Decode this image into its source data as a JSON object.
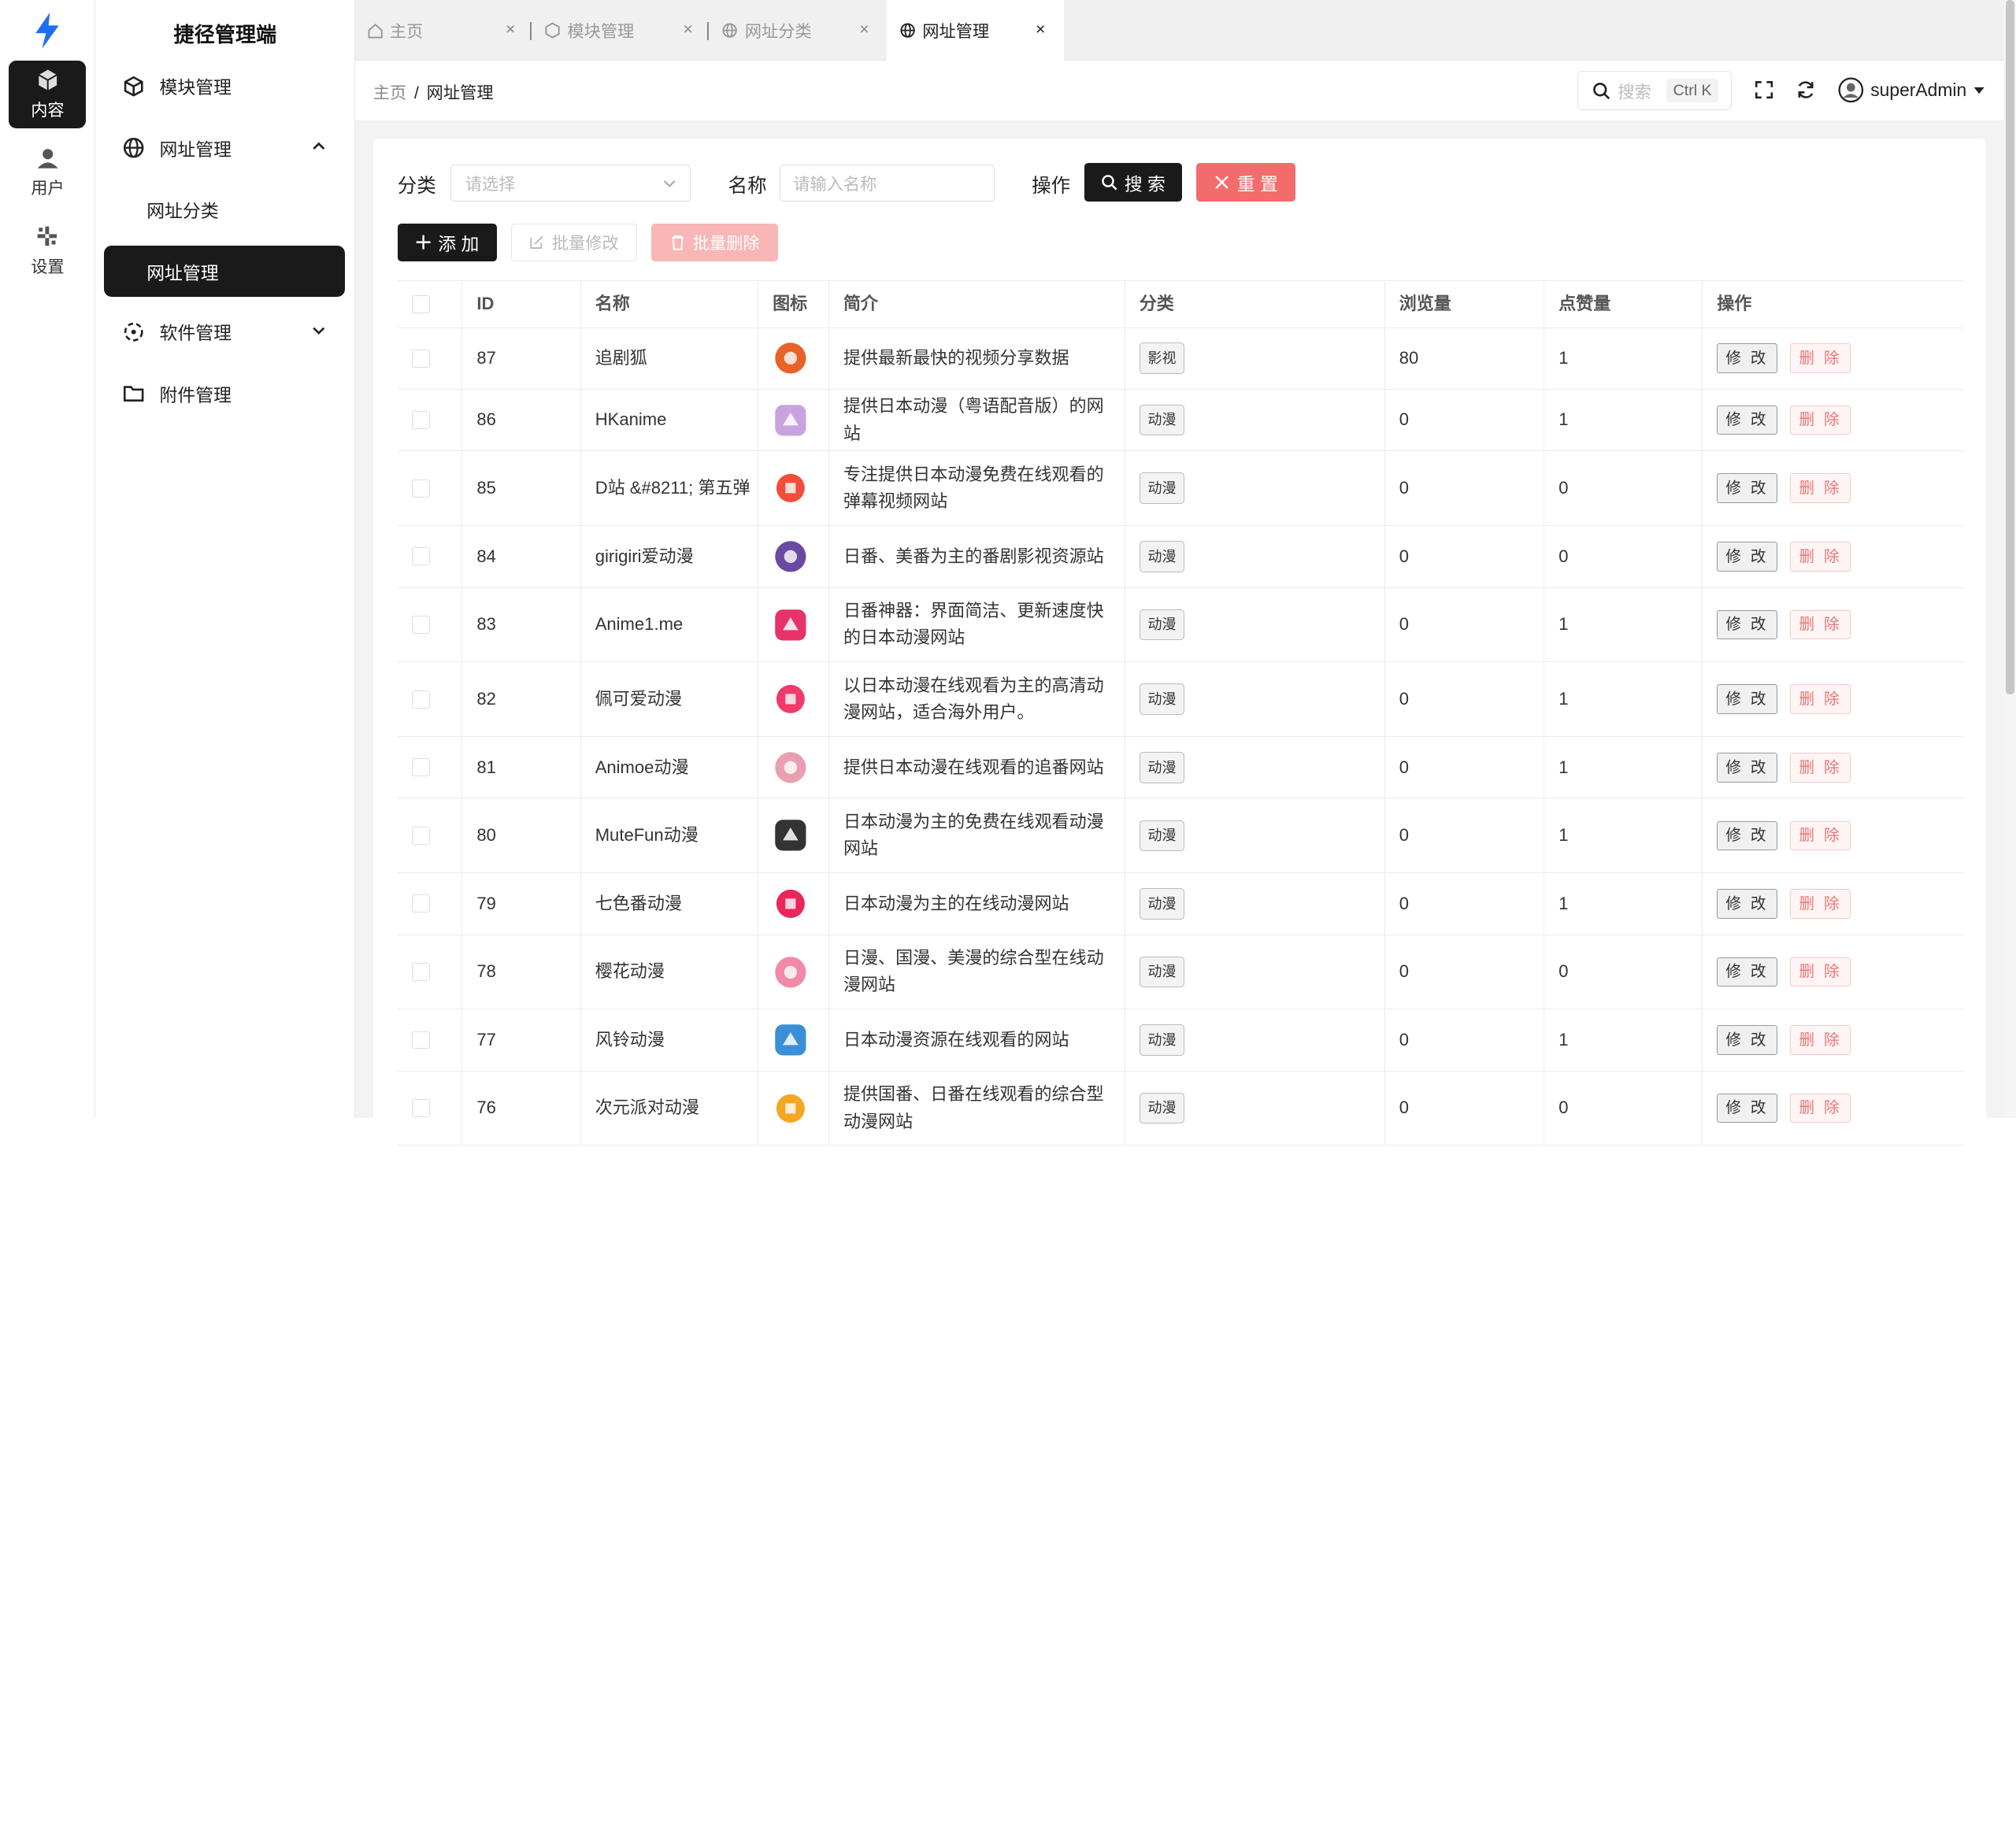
{
  "rail": {
    "items": [
      {
        "label": "内容",
        "icon": "cube-icon"
      },
      {
        "label": "用户",
        "icon": "user-icon"
      },
      {
        "label": "设置",
        "icon": "settings-icon"
      }
    ]
  },
  "sidebar": {
    "brand": "捷径管理端",
    "items": [
      {
        "label": "模块管理"
      },
      {
        "label": "网址管理"
      },
      {
        "label": "网址分类"
      },
      {
        "label": "网址管理"
      },
      {
        "label": "软件管理"
      },
      {
        "label": "附件管理"
      }
    ]
  },
  "tabs": [
    {
      "label": "主页"
    },
    {
      "label": "模块管理"
    },
    {
      "label": "网址分类"
    },
    {
      "label": "网址管理"
    }
  ],
  "header": {
    "breadcrumb_home": "主页",
    "breadcrumb_sep": "/",
    "breadcrumb_current": "网址管理",
    "search_placeholder": "搜索",
    "search_shortcut": "Ctrl K",
    "username": "superAdmin"
  },
  "filters": {
    "category_label": "分类",
    "category_placeholder": "请选择",
    "name_label": "名称",
    "name_placeholder": "请输入名称",
    "action_label": "操作",
    "search_button": "搜 索",
    "reset_button": "重 置"
  },
  "toolbar": {
    "add": "添 加",
    "batch_edit": "批量修改",
    "batch_delete": "批量删除"
  },
  "table": {
    "columns": [
      "ID",
      "名称",
      "图标",
      "简介",
      "分类",
      "浏览量",
      "点赞量",
      "操作"
    ],
    "edit_label": "修 改",
    "delete_label": "删 除",
    "rows": [
      {
        "id": "87",
        "name": "追剧狐",
        "desc": "提供最新最快的视频分享数据",
        "category": "影视",
        "views": "80",
        "likes": "1",
        "icon": "fox-icon",
        "color": "#e8622a"
      },
      {
        "id": "86",
        "name": "HKanime",
        "desc": "提供日本动漫（粤语配音版）的网站",
        "category": "动漫",
        "views": "0",
        "likes": "1",
        "icon": "anime-girl-icon",
        "color": "#c9a3e0"
      },
      {
        "id": "85",
        "name": "D站 &#8211; 第五弹",
        "desc": "专注提供日本动漫免费在线观看的弹幕视频网站",
        "category": "动漫",
        "views": "0",
        "likes": "0",
        "icon": "d-logo-icon",
        "color": "#f24d3a"
      },
      {
        "id": "84",
        "name": "girigiri爱动漫",
        "desc": "日番、美番为主的番剧影视资源站",
        "category": "动漫",
        "views": "0",
        "likes": "0",
        "icon": "anime-avatar-icon",
        "color": "#6a4aa0"
      },
      {
        "id": "83",
        "name": "Anime1.me",
        "desc": "日番神器：界面简洁、更新速度快的日本动漫网站",
        "category": "动漫",
        "views": "0",
        "likes": "1",
        "icon": "anime1-logo-icon",
        "color": "#e8326a"
      },
      {
        "id": "82",
        "name": "佩可爱动漫",
        "desc": "以日本动漫在线观看为主的高清动漫网站，适合海外用户。",
        "category": "动漫",
        "views": "0",
        "likes": "1",
        "icon": "swirl-logo-icon",
        "color": "#ef3a6a"
      },
      {
        "id": "81",
        "name": "Animoe动漫",
        "desc": "提供日本动漫在线观看的追番网站",
        "category": "动漫",
        "views": "0",
        "likes": "1",
        "icon": "animoe-logo-icon",
        "color": "#e8a0b0"
      },
      {
        "id": "80",
        "name": "MuteFun动漫",
        "desc": "日本动漫为主的免费在线观看动漫网站",
        "category": "动漫",
        "views": "0",
        "likes": "1",
        "icon": "mutefun-logo-icon",
        "color": "#333333"
      },
      {
        "id": "79",
        "name": "七色番动漫",
        "desc": "日本动漫为主的在线动漫网站",
        "category": "动漫",
        "views": "0",
        "likes": "1",
        "icon": "fun-logo-icon",
        "color": "#e8265a"
      },
      {
        "id": "78",
        "name": "樱花动漫",
        "desc": "日漫、国漫、美漫的综合型在线动漫网站",
        "category": "动漫",
        "views": "0",
        "likes": "0",
        "icon": "sakura-girl-icon",
        "color": "#f08aa8"
      },
      {
        "id": "77",
        "name": "风铃动漫",
        "desc": "日本动漫资源在线观看的网站",
        "category": "动漫",
        "views": "0",
        "likes": "1",
        "icon": "windbell-logo-icon",
        "color": "#3a8fd8"
      },
      {
        "id": "76",
        "name": "次元派对动漫",
        "desc": "提供国番、日番在线观看的综合型动漫网站",
        "category": "动漫",
        "views": "0",
        "likes": "0",
        "icon": "acg-logo-icon",
        "color": "#f5a623"
      }
    ]
  },
  "colors": {
    "accent": "#1a1a1a",
    "danger": "#f36c6c",
    "logo": "#1e6ff0"
  }
}
